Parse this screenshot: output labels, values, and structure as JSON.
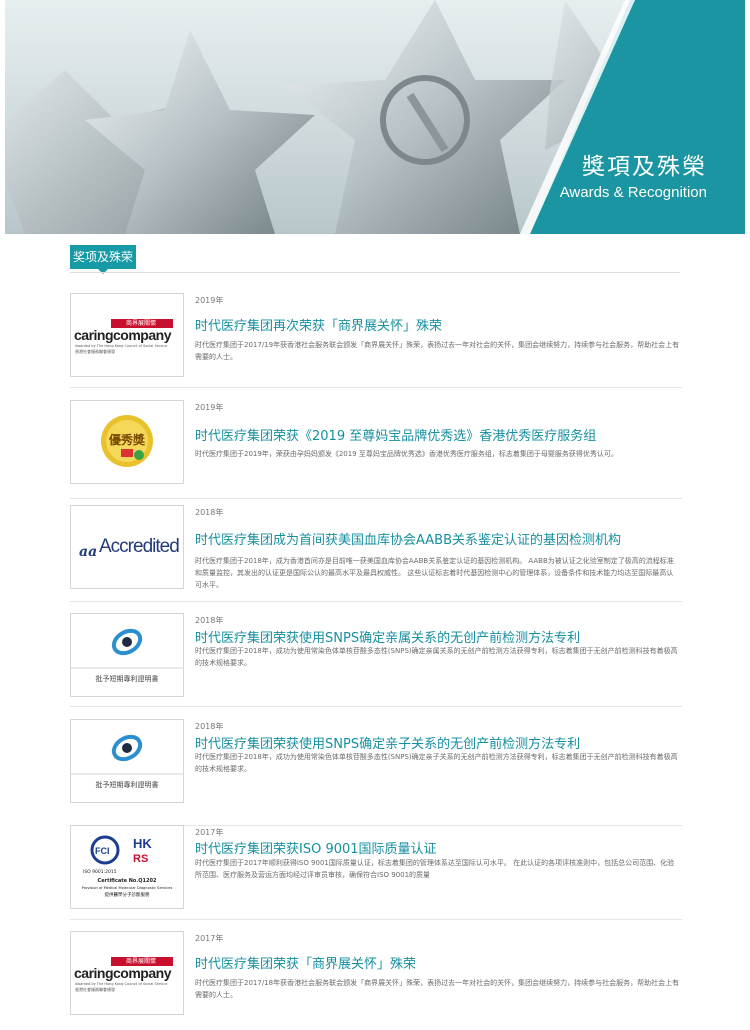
{
  "banner": {
    "title_zh": "獎項及殊榮",
    "title_en": "Awards & Recognition"
  },
  "section_tab": "奖项及殊荣",
  "colors": {
    "accent": "#169aa6",
    "title": "#168fa0"
  },
  "awards": [
    {
      "year": "2019年",
      "title": "时代医疗集团再次荣获「商界展关怀」殊荣",
      "desc": "时代医疗集团于2017/19年获香港社会服务联会颁发「商界展关怀」殊荣，表扬过去一年对社会的关怀，集团会继续努力，持续参与社会服务，帮助社会上有需要的人士。",
      "logo": "caring-company-logo"
    },
    {
      "year": "2019年",
      "title": "时代医疗集团荣获《2019 至尊妈宝品牌优秀选》香港优秀医疗服务组",
      "desc": "时代医疗集团于2019年，荣获由孕妈妈颁发《2019 至尊妈宝品牌优秀选》香港优秀医疗服务组，标志着集团于母婴服务获得优秀认可。",
      "logo": "supreme-brand-award-logo",
      "logo_text": "優秀獎"
    },
    {
      "year": "2018年",
      "title": "时代医疗集团成为首间获美国血库协会AABB关系鉴定认证的基因检测机构",
      "desc": "时代医疗集团于2018年，成为香港首间亦是目前唯一获美国血库协会AABB关系鉴定认证的基因检测机构。 AABB为被认证之化验室制定了极高的流程标准和质量监控，其发出的认证更是国际公认的最高水平及最具权威性。 这些认证标志着时代基因检测中心的管理体系，设备条件和技术能力均达至国际最高认可水平。",
      "logo": "aabb-accredited-logo",
      "logo_text": "Accredited"
    },
    {
      "year": "2018年",
      "title": "时代医疗集团荣获使用SNPS确定亲属关系的无创产前检测方法专利",
      "desc": "时代医疗集团于2018年，成功为使用常染色体单核苷酸多态性(SNPS)确定亲属关系的无创产前检测方法获得专利，标志着集团于无创产前检测科技有着极高的技术规格要求。",
      "logo": "patent-certificate-logo",
      "logo_caption": "批予短期專利證明書"
    },
    {
      "year": "2018年",
      "title": "时代医疗集团荣获使用SNPS确定亲子关系的无创产前检测方法专利",
      "desc": "时代医疗集团于2018年，成功为使用常染色体单核苷酸多态性(SNPS)确定亲子关系的无创产前检测方法获得专利，标志着集团于无创产前检测科技有着极高的技术规格要求。",
      "logo": "patent-certificate-logo",
      "logo_caption": "批予短期專利證明書"
    },
    {
      "year": "2017年",
      "title": "时代医疗集团荣获ISO 9001国际质量认证",
      "desc": "时代医疗集团于2017年顺利获得ISO 9001国际质量认证，标志着集团的管理体系达至国际认可水平。 在此认证的各项评核准则中，包括总公司范围、化验所范围、医疗服务及营运方面均经过评审员审核，确保符合ISO 9001的质量",
      "logo": "iso-9001-certificate-logo",
      "logo_lines": [
        "ISO 9001:2015",
        "Certificate No.Q1202",
        "Provision of Medical Molecular Diagnostic Services",
        "提供醫學分子診斷服務"
      ]
    },
    {
      "year": "2017年",
      "title": "时代医疗集团荣获「商界展关怀」殊荣",
      "desc": "时代医疗集团于2017/18年获香港社会服务联会颁发「商界展关怀」殊荣，表扬过去一年对社会的关怀，集团会继续努力，持续参与社会服务，帮助社会上有需要的人士。",
      "logo": "caring-company-logo"
    }
  ],
  "caring_logo": {
    "badge": "商界展關懷",
    "word": "caringcompany",
    "sub": "Awarded by The Hong Kong Council of Social Service",
    "sub_zh": "香港社會服務聯會頒發"
  }
}
